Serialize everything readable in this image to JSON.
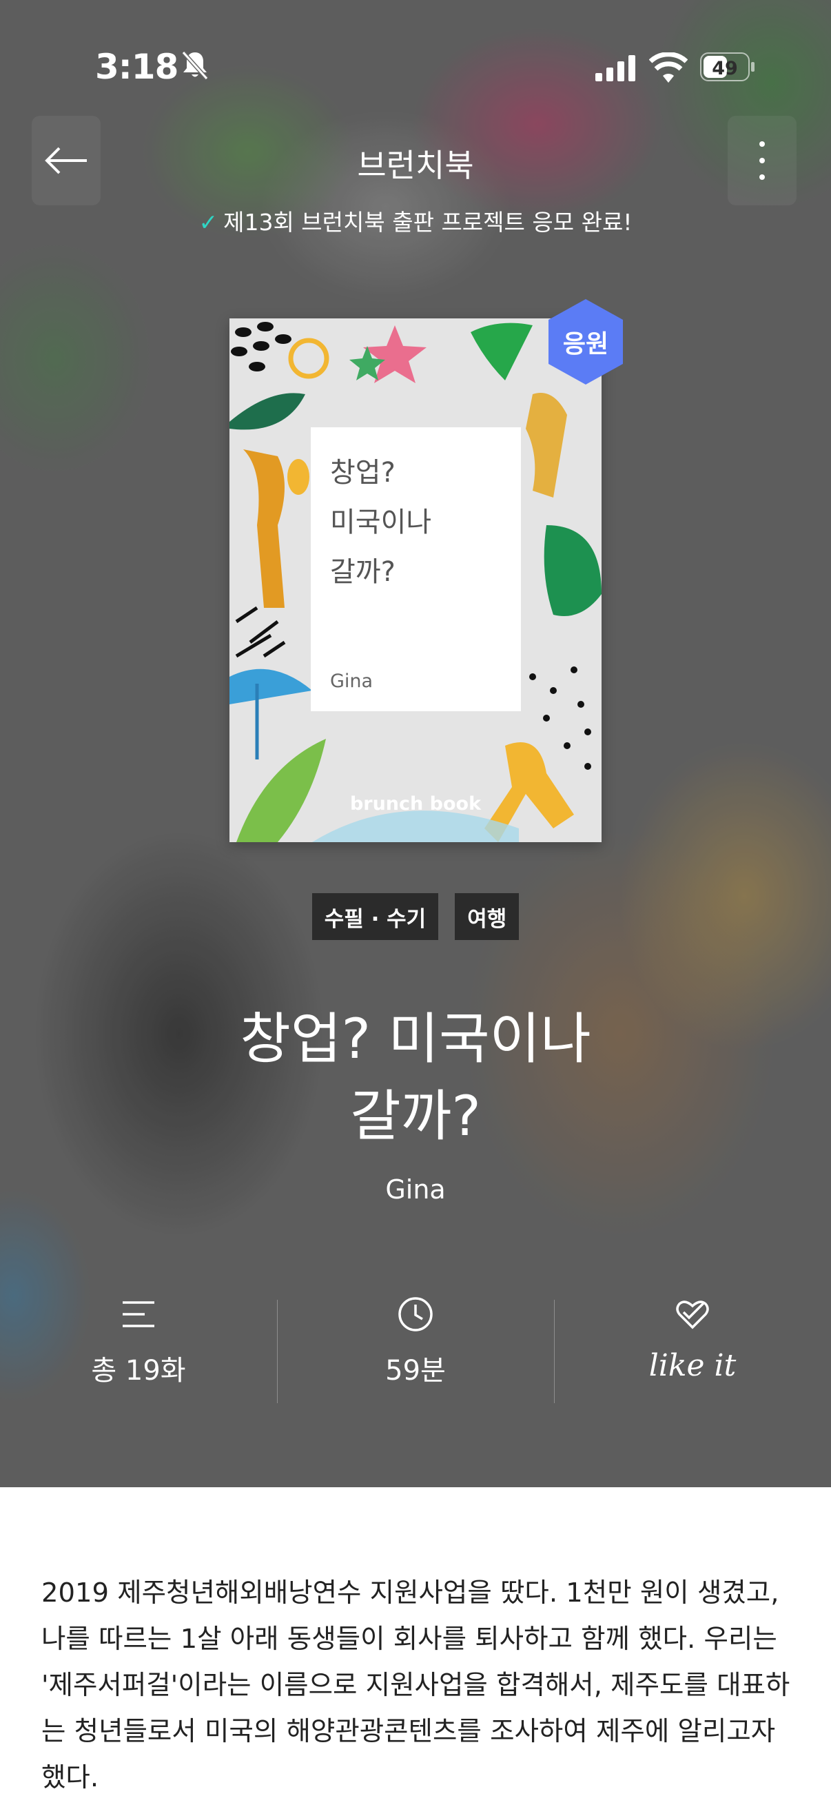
{
  "status_bar": {
    "time": "3:18",
    "battery": "49"
  },
  "header": {
    "title": "브런치북",
    "notice": "제13회 브런치북 출판 프로젝트 응모 완료!"
  },
  "cover": {
    "title": "창업?\n미국이나\n갈까?",
    "author": "Gina",
    "brand": "brunch book",
    "badge": "응원"
  },
  "tags": [
    "수필 · 수기",
    "여행"
  ],
  "book": {
    "title": "창업? 미국이나\n갈까?",
    "author": "Gina"
  },
  "stats": {
    "episodes": "총 19화",
    "duration": "59분",
    "like": "like it"
  },
  "description": "2019 제주청년해외배낭연수 지원사업을 땄다. 1천만 원이 생겼고, 나를 따르는 1살 아래 동생들이 회사를 퇴사하고 함께 했다. 우리는 '제주서퍼걸'이라는 이름으로 지원사업을 합격해서, 제주도를 대표하는 청년들로서 미국의 해양관광콘텐츠를 조사하여 제주에 알리고자 했다.",
  "colors": {
    "check": "#2fd6c4",
    "badge": "#5b7cf5",
    "tag_bg": "#2b2b2b"
  }
}
